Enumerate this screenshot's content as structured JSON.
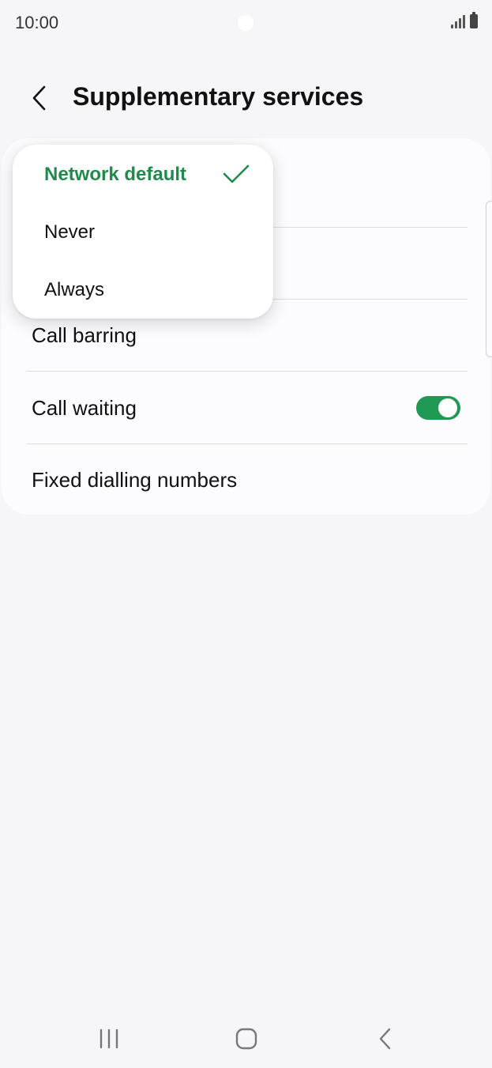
{
  "status_bar": {
    "time": "10:00",
    "icons": [
      "signal-icon",
      "battery-icon"
    ]
  },
  "header": {
    "title": "Supplementary services",
    "back_icon": "chevron-left-icon"
  },
  "settings": {
    "items": [
      {
        "label": "Call barring"
      },
      {
        "label": "Call waiting",
        "toggle": true
      },
      {
        "label": "Fixed dialling numbers"
      }
    ]
  },
  "popup_menu": {
    "options": [
      {
        "label": "Network default",
        "selected": true
      },
      {
        "label": "Never",
        "selected": false
      },
      {
        "label": "Always",
        "selected": false
      }
    ],
    "check_icon": "check-icon"
  },
  "nav_bar": {
    "buttons": [
      "recent-apps-icon",
      "home-icon",
      "back-icon"
    ]
  },
  "colors": {
    "accent_green": "#1f8a4c",
    "toggle_on": "#1f9954",
    "background": "#f6f6f8"
  }
}
